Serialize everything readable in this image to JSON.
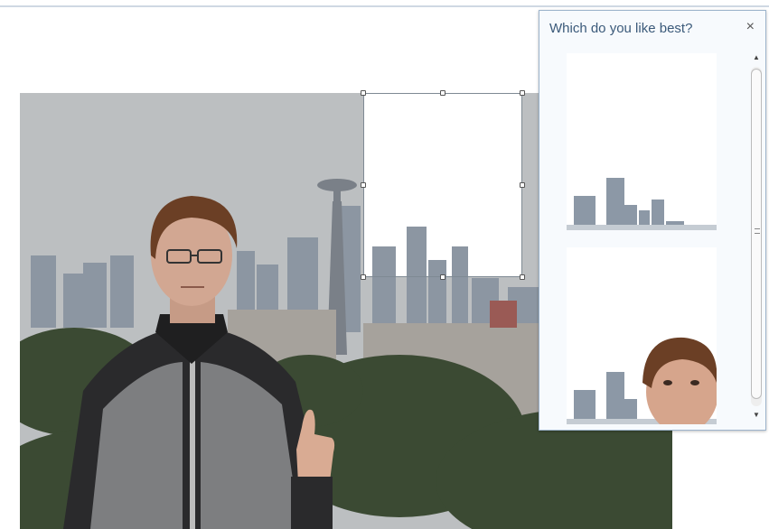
{
  "suggestion_panel": {
    "title": "Which do you like best?",
    "close_symbol": "×",
    "options": [
      {
        "name": "crop-option-skyline"
      },
      {
        "name": "crop-option-face"
      }
    ],
    "scroll_up_symbol": "▲",
    "scroll_down_symbol": "▼"
  },
  "colors": {
    "panel_title": "#3b5a7a",
    "panel_border": "#9db4cc",
    "selection_border": "#7f8a94"
  },
  "icons": [
    "close-icon",
    "scroll-up-arrow-icon",
    "scroll-down-arrow-icon",
    "scroll-grip-icon"
  ]
}
